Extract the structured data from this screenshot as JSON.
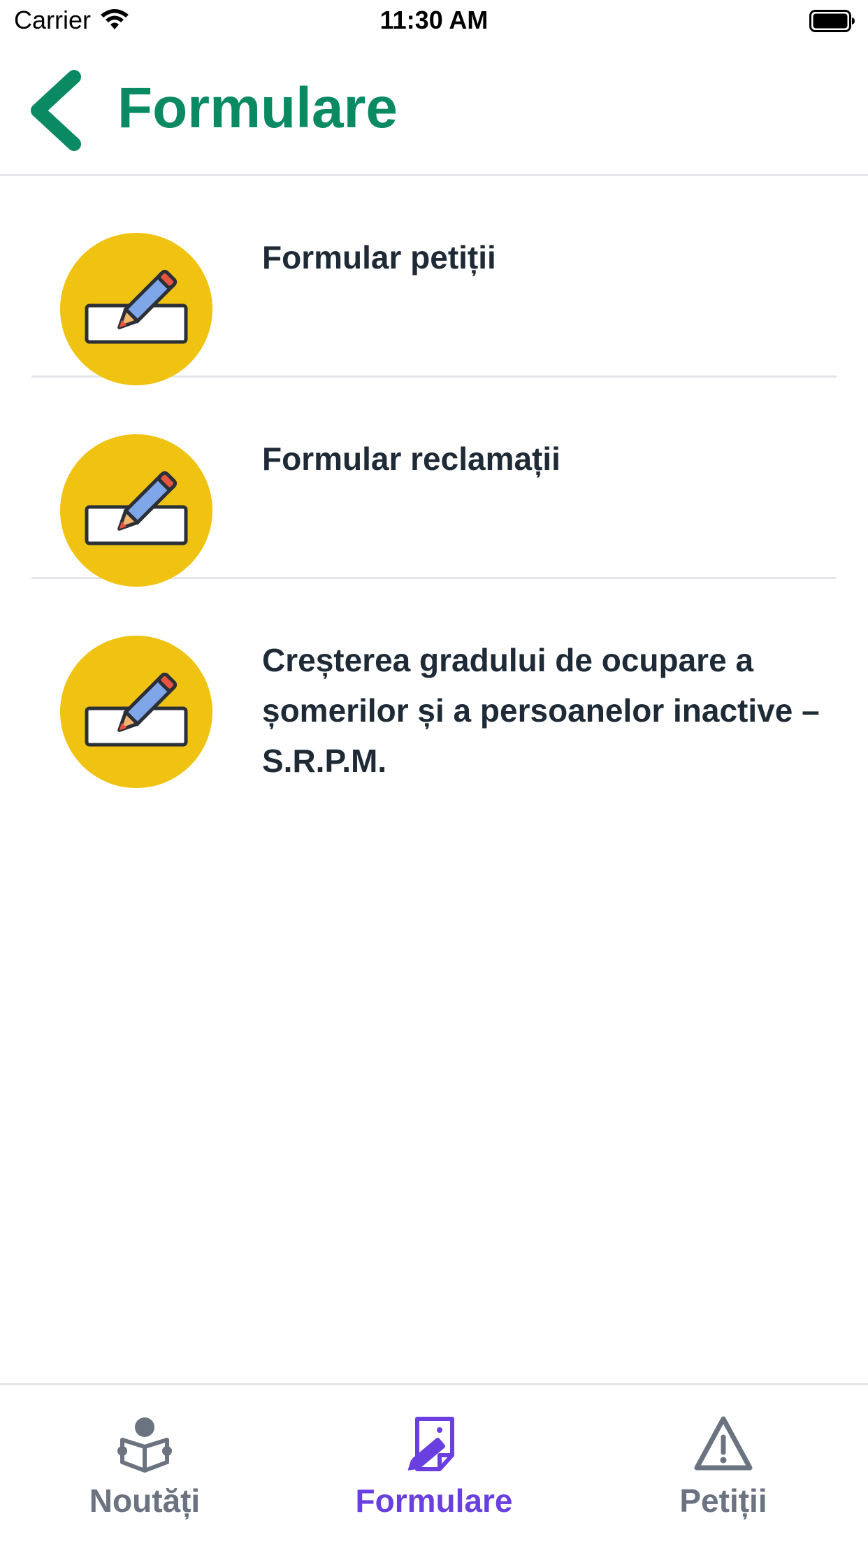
{
  "status_bar": {
    "carrier": "Carrier",
    "time": "11:30 AM",
    "wifi_icon": "wifi-icon",
    "battery_icon": "battery-icon"
  },
  "header": {
    "title": "Formulare",
    "back_icon": "chevron-left-icon"
  },
  "forms": [
    {
      "label": "Formular petiții",
      "icon": "edit-form-icon"
    },
    {
      "label": "Formular reclamații",
      "icon": "edit-form-icon"
    },
    {
      "label": "Creșterea gradului de ocupare a șomerilor și a persoanelor inactive – S.R.P.M.",
      "icon": "edit-form-icon"
    }
  ],
  "tabs": [
    {
      "label": "Noutăți",
      "icon": "news-reader-icon",
      "active": false
    },
    {
      "label": "Formulare",
      "icon": "form-pen-icon",
      "active": true
    },
    {
      "label": "Petiții",
      "icon": "warning-triangle-icon",
      "active": false
    }
  ],
  "colors": {
    "accent_green": "#0a8a63",
    "icon_yellow": "#f0c312",
    "tab_active": "#6a3fe0",
    "tab_inactive": "#6b7280",
    "text_dark": "#1f2a37",
    "divider": "#e3e5e8"
  }
}
